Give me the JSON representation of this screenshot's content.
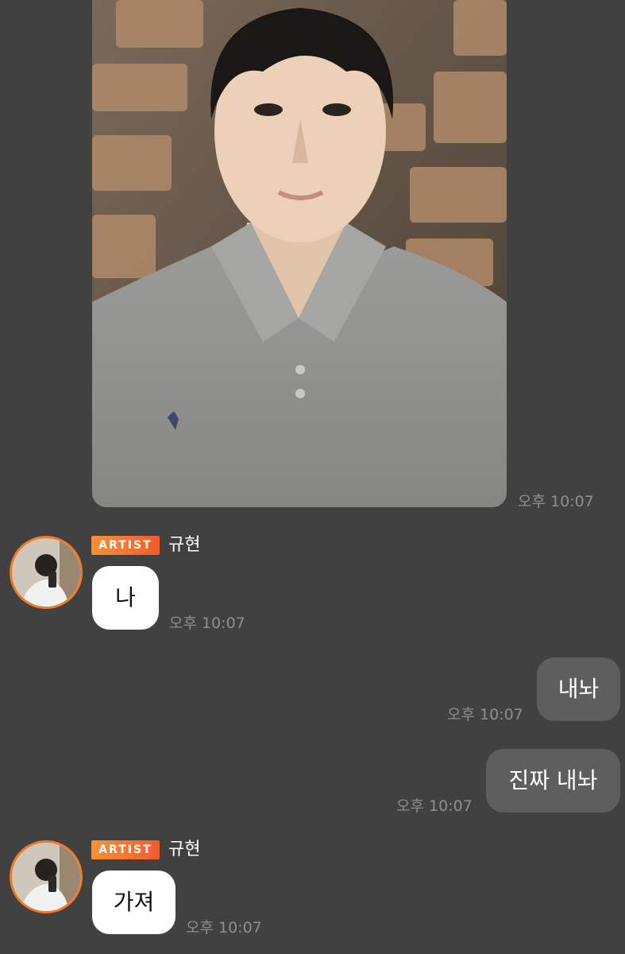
{
  "colors": {
    "background": "#414141",
    "incoming_bubble": "#ffffff",
    "outgoing_bubble": "#5e5e5e",
    "timestamp": "#8e8e8e",
    "artist_badge_start": "#f79233",
    "artist_badge_end": "#f35b2e",
    "avatar_ring": "#f07a2a"
  },
  "messages": [
    {
      "kind": "photo",
      "direction": "incoming",
      "image": "selfie-photo",
      "time": "오후 10:07"
    },
    {
      "kind": "text",
      "direction": "incoming",
      "badge": "ARTIST",
      "sender": "규현",
      "text": "나",
      "time": "오후 10:07"
    },
    {
      "kind": "text",
      "direction": "outgoing",
      "text": "내놔",
      "time": "오후 10:07"
    },
    {
      "kind": "text",
      "direction": "outgoing",
      "text": "진짜 내놔",
      "time": "오후 10:07"
    },
    {
      "kind": "text",
      "direction": "incoming",
      "badge": "ARTIST",
      "sender": "규현",
      "text": "가져",
      "time": "오후 10:07"
    }
  ]
}
